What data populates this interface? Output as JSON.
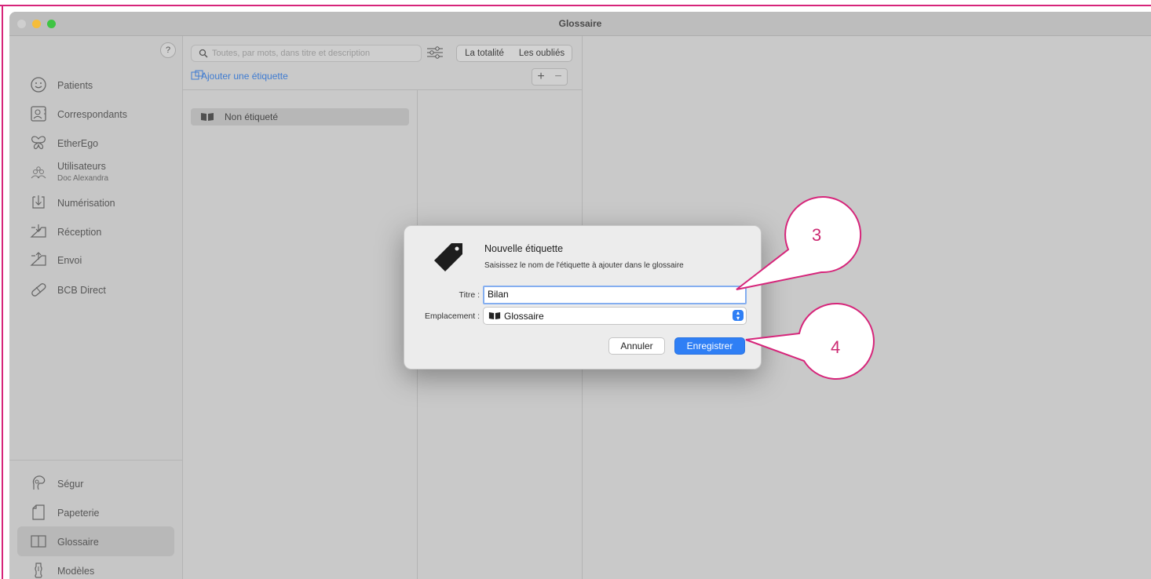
{
  "window": {
    "title": "Glossaire"
  },
  "sidebar": {
    "help": "?",
    "top_items": [
      {
        "label": "Patients",
        "icon": "smiley-icon"
      },
      {
        "label": "Correspondants",
        "icon": "contact-card-icon"
      },
      {
        "label": "EtherEgo",
        "icon": "butterfly-icon"
      },
      {
        "label": "Utilisateurs",
        "sub": "Doc Alexandra",
        "icon": "users-icon"
      },
      {
        "label": "Numérisation",
        "icon": "scan-icon"
      },
      {
        "label": "Réception",
        "icon": "inbox-icon"
      },
      {
        "label": "Envoi",
        "icon": "outbox-icon"
      },
      {
        "label": "BCB Direct",
        "icon": "pill-icon"
      }
    ],
    "bottom_items": [
      {
        "label": "Ségur",
        "icon": "segur-icon"
      },
      {
        "label": "Papeterie",
        "icon": "paper-icon"
      },
      {
        "label": "Glossaire",
        "icon": "book-icon"
      },
      {
        "label": "Modèles",
        "icon": "mannequin-icon"
      }
    ]
  },
  "toolbar": {
    "search_placeholder": "Toutes, par mots, dans titre et description",
    "filter_all": "La totalité",
    "filter_forgotten": "Les oubliés",
    "add_tag": "Ajouter une étiquette",
    "plus": "+",
    "minus": "−"
  },
  "tags": [
    {
      "label": "Non étiqueté"
    }
  ],
  "dialog": {
    "title": "Nouvelle étiquette",
    "subtitle": "Saisissez le nom de l'étiquette à ajouter dans le glossaire",
    "title_label": "Titre :",
    "title_value": "Bilan",
    "location_label": "Emplacement :",
    "location_value": "Glossaire",
    "cancel": "Annuler",
    "save": "Enregistrer"
  },
  "callouts": [
    "3",
    "4"
  ],
  "colors": {
    "annotation": "#d6257a",
    "accent": "#2f7ff5",
    "link": "#3e7bd1"
  }
}
